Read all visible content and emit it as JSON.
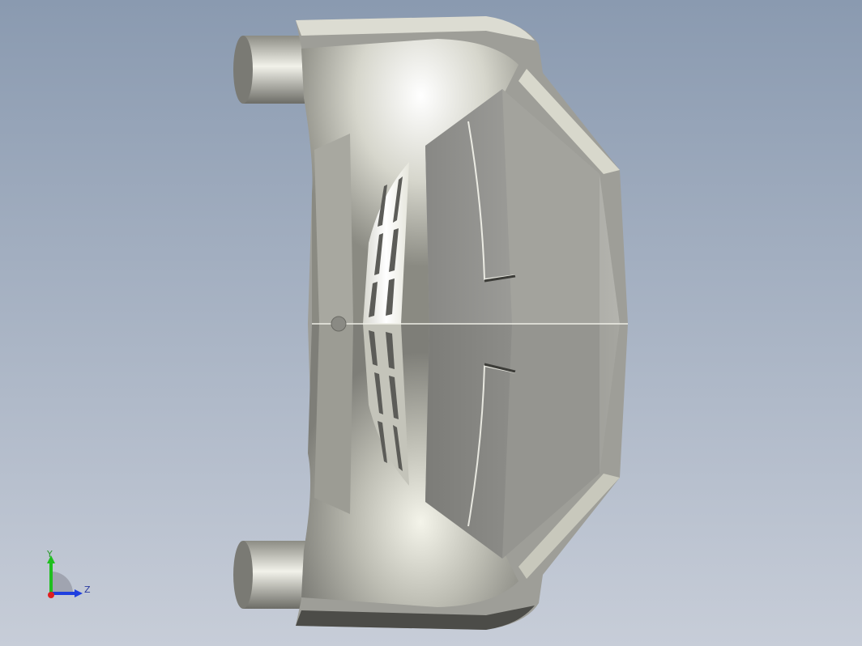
{
  "viewport": {
    "background_top": "#8a9ab0",
    "background_bottom": "#c7cdd8"
  },
  "model": {
    "icon": "car-body-3d-model",
    "shading_light": "#f7f7f0",
    "shading_mid": "#b8b8ac",
    "shading_dark": "#6e6e68"
  },
  "triad": {
    "y_label": "Y",
    "z_label": "Z",
    "y_color": "#1fbf1f",
    "z_color": "#1f3fdf",
    "x_color": "#df1f1f"
  }
}
